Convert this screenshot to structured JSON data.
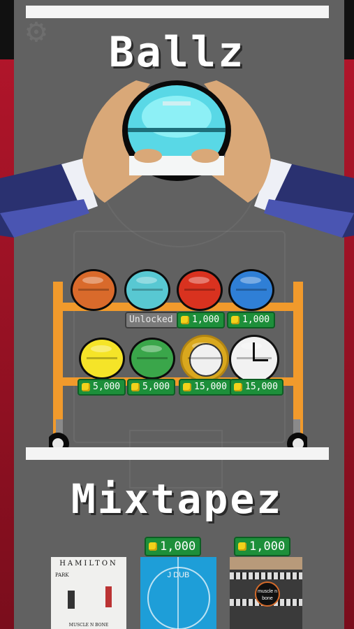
{
  "screen_title": "Ballz",
  "mixtapes_title": "Mixtapez",
  "icons": {
    "settings": "gear-icon",
    "coin": "coin-icon"
  },
  "balls_row1": [
    {
      "id": "ball-orange",
      "color": "#d96a2b",
      "status": "",
      "price": ""
    },
    {
      "id": "ball-cyan",
      "color": "#58c8d2",
      "status": "Unlocked",
      "price": ""
    },
    {
      "id": "ball-red",
      "color": "#d9321f",
      "status": "",
      "price": "1,000"
    },
    {
      "id": "ball-blue-green",
      "color": "#2da64b",
      "status": "",
      "price": "1,000"
    }
  ],
  "balls_row2": [
    {
      "id": "ball-yellow",
      "color": "#f5e428",
      "price": "5,000"
    },
    {
      "id": "ball-green",
      "color": "#3aa64a",
      "price": "5,000"
    },
    {
      "id": "ball-soccer",
      "color": "#d9a81e",
      "price": "15,000"
    },
    {
      "id": "ball-clock",
      "color": "#f2f2f2",
      "price": "15,000"
    }
  ],
  "mixtapes": [
    {
      "title": "HAMILTON",
      "subtitle": "PARK",
      "footer": "MUSCLE N BONE",
      "price": ""
    },
    {
      "title": "J DUB",
      "price": "1,000"
    },
    {
      "title": "muscle n bone",
      "price": "1,000"
    }
  ]
}
